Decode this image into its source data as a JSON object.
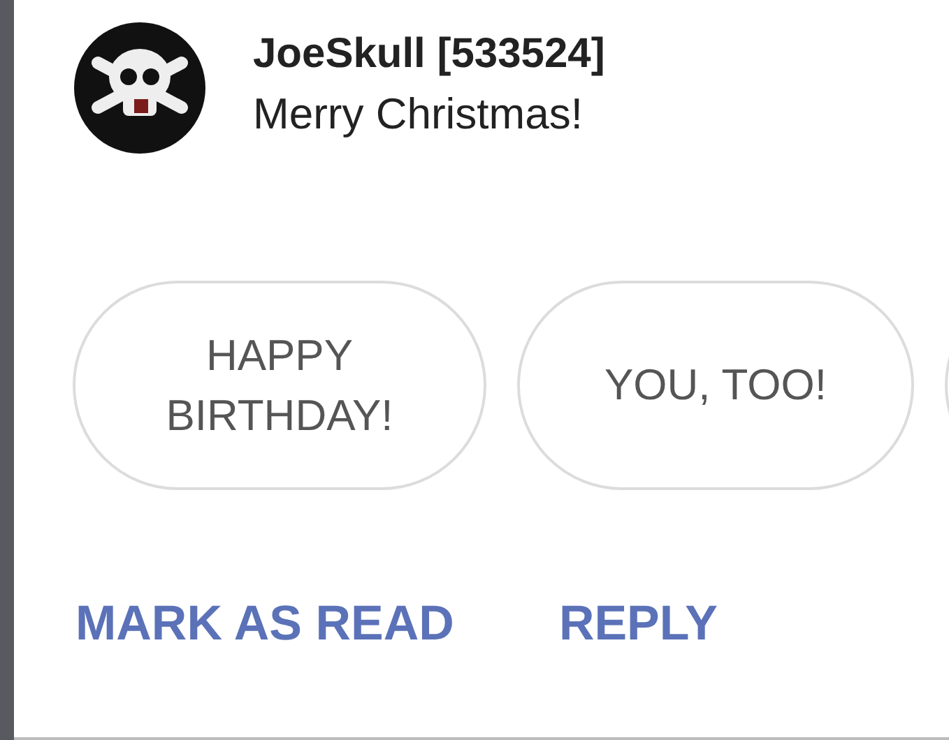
{
  "notification": {
    "sender": "JoeSkull [533524]",
    "message": "Merry Christmas!"
  },
  "quick_replies": [
    {
      "label": "HAPPY BIRTHDAY!"
    },
    {
      "label": "YOU, TOO!"
    }
  ],
  "actions": [
    {
      "label": "MARK AS READ"
    },
    {
      "label": "REPLY"
    }
  ]
}
